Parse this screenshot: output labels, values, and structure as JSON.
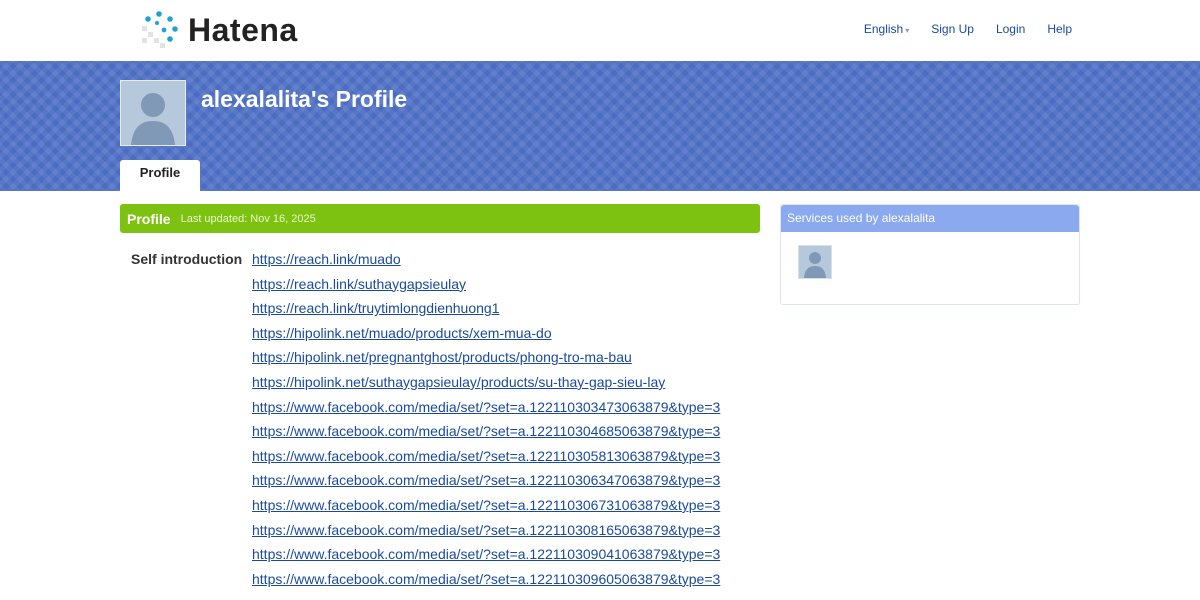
{
  "brand": {
    "name": "Hatena"
  },
  "topnav": {
    "language": "English",
    "signup": "Sign Up",
    "login": "Login",
    "help": "Help"
  },
  "profile": {
    "title": "alexalalita's Profile",
    "tab_label": "Profile",
    "section_title": "Profile",
    "last_updated": "Last updated: Nov 16, 2025",
    "self_intro_label": "Self introduction",
    "links": [
      "https://reach.link/muado",
      "https://reach.link/suthaygapsieulay",
      "https://reach.link/truytimlongdienhuong1",
      "https://hipolink.net/muado/products/xem-mua-do",
      "https://hipolink.net/pregnantghost/products/phong-tro-ma-bau",
      "https://hipolink.net/suthaygapsieulay/products/su-thay-gap-sieu-lay",
      "https://www.facebook.com/media/set/?set=a.122110303473063879&type=3",
      "https://www.facebook.com/media/set/?set=a.122110304685063879&type=3",
      "https://www.facebook.com/media/set/?set=a.122110305813063879&type=3",
      "https://www.facebook.com/media/set/?set=a.122110306347063879&type=3",
      "https://www.facebook.com/media/set/?set=a.122110306731063879&type=3",
      "https://www.facebook.com/media/set/?set=a.122110308165063879&type=3",
      "https://www.facebook.com/media/set/?set=a.122110309041063879&type=3",
      "https://www.facebook.com/media/set/?set=a.122110309605063879&type=3"
    ]
  },
  "sidebar": {
    "services_title": "Services used by alexalalita"
  },
  "colors": {
    "banner": "#4a6cc2",
    "profile_bar": "#7dc210",
    "link": "#1a4a9c",
    "services_header": "#8aa9ef"
  },
  "icons": [
    "hatena-logo-icon",
    "avatar-placeholder-icon",
    "dropdown-caret-icon"
  ]
}
